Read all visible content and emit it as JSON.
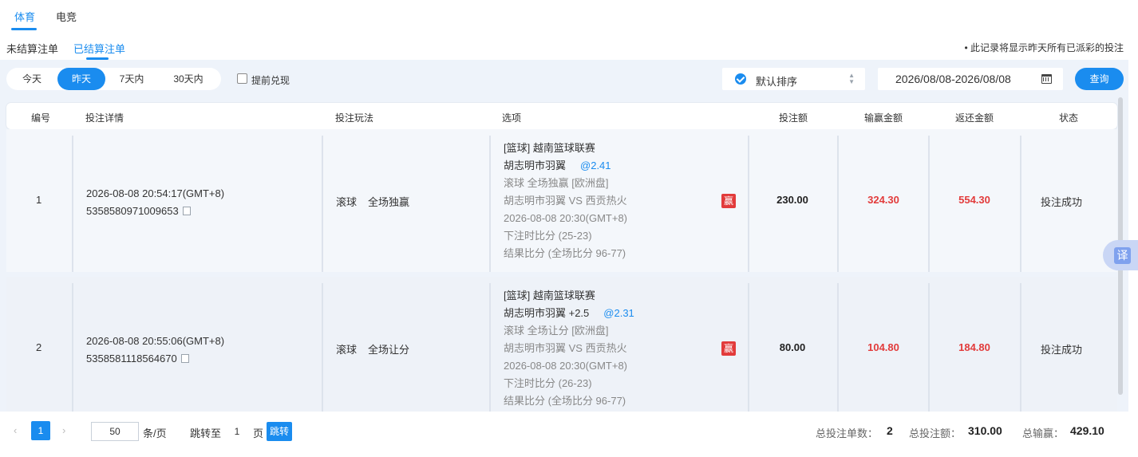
{
  "top_tabs": [
    {
      "label": "体育",
      "active": true
    },
    {
      "label": "电竞",
      "active": false
    }
  ],
  "sub_tabs": [
    {
      "label": "未结算注单",
      "active": false
    },
    {
      "label": "已结算注单",
      "active": true
    }
  ],
  "notice": "• 此记录将显示昨天所有已派彩的投注",
  "filters": {
    "ranges": [
      {
        "label": "今天",
        "active": false
      },
      {
        "label": "昨天",
        "active": true
      },
      {
        "label": "7天内",
        "active": false
      },
      {
        "label": "30天内",
        "active": false
      }
    ],
    "cashout_label": "提前兑现",
    "cashout_checked": false,
    "sort_label": "默认排序",
    "date_range": "2026/08/08-2026/08/08",
    "query_label": "查询"
  },
  "table": {
    "headers": [
      "编号",
      "投注详情",
      "投注玩法",
      "选项",
      "投注额",
      "输赢金额",
      "返还金额",
      "状态"
    ],
    "rows": [
      {
        "no": "1",
        "time": "2026-08-08 20:54:17(GMT+8)",
        "bet_id": "5358580971009653",
        "play_type": "滚球",
        "play_name": "全场独赢",
        "league": "[篮球] 越南篮球联赛",
        "pick": "胡志明市羽翼",
        "odds": "@2.41",
        "market": "滚球 全场独赢 [欧洲盘]",
        "match": "胡志明市羽翼 VS 西贡热火",
        "match_time": "2026-08-08 20:30(GMT+8)",
        "score_at_bet": "下注时比分 (25-23)",
        "result_score": "结果比分 (全场比分 96-77)",
        "badge": "赢",
        "stake": "230.00",
        "win_loss": "324.30",
        "return": "554.30",
        "status": "投注成功"
      },
      {
        "no": "2",
        "time": "2026-08-08 20:55:06(GMT+8)",
        "bet_id": "5358581118564670",
        "play_type": "滚球",
        "play_name": "全场让分",
        "league": "[篮球] 越南篮球联赛",
        "pick": "胡志明市羽翼 +2.5",
        "odds": "@2.31",
        "market": "滚球 全场让分 [欧洲盘]",
        "match": "胡志明市羽翼 VS 西贡热火",
        "match_time": "2026-08-08 20:30(GMT+8)",
        "score_at_bet": "下注时比分 (26-23)",
        "result_score": "结果比分 (全场比分 96-77)",
        "badge": "赢",
        "stake": "80.00",
        "win_loss": "104.80",
        "return": "184.80",
        "status": "投注成功"
      }
    ]
  },
  "pagination": {
    "prev": "‹",
    "current_page": "1",
    "next": "›",
    "page_size": "50",
    "per_page_suffix": "条/页",
    "jump_prefix": "跳转至",
    "jump_value": "1",
    "jump_suffix": "页",
    "jump_button": "跳转"
  },
  "summary": {
    "count_label": "总投注单数：",
    "count_value": "2",
    "stake_label": "总投注额：",
    "stake_value": "310.00",
    "win_label": "总输赢：",
    "win_value": "429.10"
  },
  "translate_label": "译",
  "colors": {
    "accent": "#1a8cef",
    "win_red": "#e23b3b"
  }
}
